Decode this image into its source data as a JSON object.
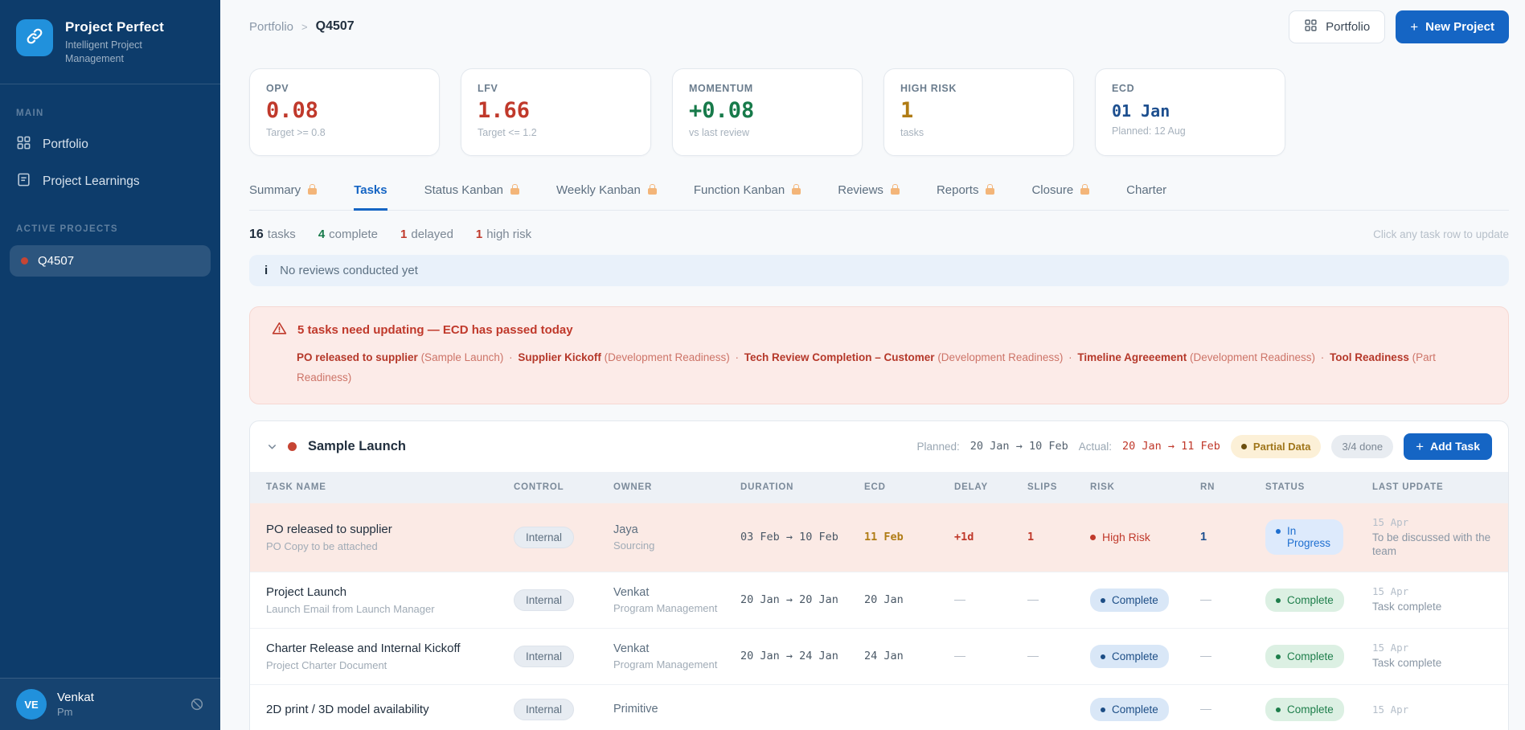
{
  "app": {
    "name": "Project Perfect",
    "tagline": "Intelligent Project Management"
  },
  "sidebar": {
    "main_section_label": "MAIN",
    "nav": [
      {
        "label": "Portfolio"
      },
      {
        "label": "Project Learnings"
      }
    ],
    "projects_section_label": "ACTIVE PROJECTS",
    "active_project": {
      "label": "Q4507"
    },
    "user": {
      "initials": "VE",
      "name": "Venkat",
      "role": "Pm"
    }
  },
  "topbar": {
    "breadcrumb": {
      "parent": "Portfolio",
      "separator": ">",
      "current": "Q4507"
    },
    "portfolio_button_label": "Portfolio",
    "new_project_plus": "+",
    "new_project_button_label": "New Project"
  },
  "kpis": [
    {
      "label": "OPV",
      "value": "0.08",
      "sub": "Target >= 0.8"
    },
    {
      "label": "LFV",
      "value": "1.66",
      "sub": "Target <= 1.2"
    },
    {
      "label": "MOMENTUM",
      "value": "+0.08",
      "sub": "vs last review"
    },
    {
      "label": "HIGH RISK",
      "value": "1",
      "sub": "tasks"
    },
    {
      "label": "ECD",
      "value": "01 Jan",
      "sub": "Planned: 12 Aug"
    }
  ],
  "tabs": [
    {
      "label": "Summary",
      "locked": true,
      "active": false
    },
    {
      "label": "Tasks",
      "locked": false,
      "active": true
    },
    {
      "label": "Status Kanban",
      "locked": true,
      "active": false
    },
    {
      "label": "Weekly Kanban",
      "locked": true,
      "active": false
    },
    {
      "label": "Function Kanban",
      "locked": true,
      "active": false
    },
    {
      "label": "Reviews",
      "locked": true,
      "active": false
    },
    {
      "label": "Reports",
      "locked": true,
      "active": false
    },
    {
      "label": "Closure",
      "locked": true,
      "active": false
    },
    {
      "label": "Charter",
      "locked": false,
      "active": false
    }
  ],
  "stats": {
    "tasks_value": "16",
    "tasks_label": "tasks",
    "complete_value": "4",
    "complete_label": "complete",
    "delayed_value": "1",
    "delayed_label": "delayed",
    "highrisk_value": "1",
    "highrisk_label": "high risk",
    "hint": "Click any task row to update"
  },
  "info_banner": {
    "icon": "i",
    "text": "No reviews conducted yet"
  },
  "warning_banner": {
    "title": "5 tasks need updating — ECD has passed today",
    "separator": "·",
    "tasks": [
      {
        "name": "PO released to supplier",
        "context": " (Sample Launch) "
      },
      {
        "name": "Supplier Kickoff",
        "context": " (Development Readiness) "
      },
      {
        "name": "Tech Review Completion – Customer",
        "context": " (Development Readiness) "
      },
      {
        "name": "Timeline Agreeement",
        "context": " (Development Readiness) "
      },
      {
        "name": "Tool Readiness",
        "context": " (Part Readiness)"
      }
    ]
  },
  "group": {
    "name": "Sample Launch",
    "planned_label": "Planned:",
    "planned_value": "20 Jan → 10 Feb",
    "actual_label": "Actual:",
    "actual_value": "20 Jan → 11 Feb",
    "partial_badge": "Partial Data",
    "done_badge": "3/4 done",
    "add_task_plus": "+",
    "add_task_label": "Add Task"
  },
  "table": {
    "columns": [
      "TASK NAME",
      "CONTROL",
      "OWNER",
      "DURATION",
      "ECD",
      "DELAY",
      "SLIPS",
      "RISK",
      "RN",
      "STATUS",
      "LAST UPDATE"
    ],
    "rows": [
      {
        "name": "PO released to supplier",
        "subtitle": "PO Copy to be attached",
        "control": "Internal",
        "owner": "Jaya",
        "owner_dept": "Sourcing",
        "duration": "03 Feb → 10 Feb",
        "ecd": "11 Feb",
        "delay": "+1d",
        "slips": "1",
        "risk": "High Risk",
        "rn": "1",
        "status": "In Progress",
        "update_date": "15 Apr",
        "update_note": "To be discussed with the team"
      },
      {
        "name": "Project Launch",
        "subtitle": "Launch Email from Launch Manager",
        "control": "Internal",
        "owner": "Venkat",
        "owner_dept": "Program Management",
        "duration": "20 Jan → 20 Jan",
        "ecd": "20 Jan",
        "delay": "—",
        "slips": "—",
        "risk": "Complete",
        "rn": "—",
        "status": "Complete",
        "update_date": "15 Apr",
        "update_note": "Task complete"
      },
      {
        "name": "Charter Release and Internal Kickoff",
        "subtitle": "Project Charter Document",
        "control": "Internal",
        "owner": "Venkat",
        "owner_dept": "Program Management",
        "duration": "20 Jan → 24 Jan",
        "ecd": "24 Jan",
        "delay": "—",
        "slips": "—",
        "risk": "Complete",
        "rn": "—",
        "status": "Complete",
        "update_date": "15 Apr",
        "update_note": "Task complete"
      },
      {
        "name": "2D print / 3D model availability",
        "subtitle": "",
        "control": "Internal",
        "owner": "Primitive",
        "owner_dept": "",
        "duration": "",
        "ecd": "",
        "delay": "",
        "slips": "",
        "risk": "Complete",
        "rn": "—",
        "status": "Complete",
        "update_date": "15 Apr",
        "update_note": ""
      }
    ]
  },
  "theme": {
    "accent_blue": "#1565c4",
    "sidebar_navy": "#0d3c6b",
    "alert_red": "#c0392b",
    "success_green": "#177a4a",
    "warn_amber": "#b07c15",
    "ecd_navy": "#1d4f8f"
  }
}
